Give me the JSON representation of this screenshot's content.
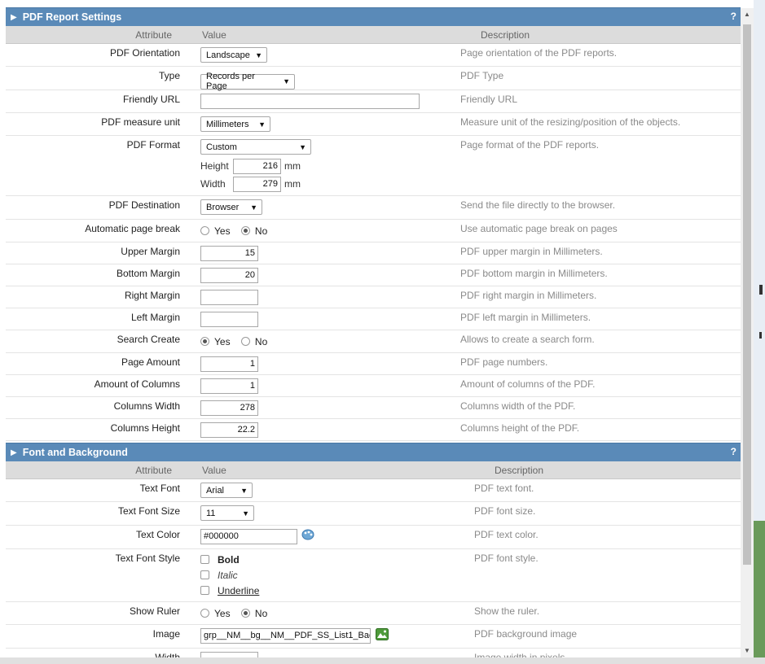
{
  "pdf_section": {
    "title": "PDF Report Settings",
    "help": "?",
    "columns": {
      "attribute": "Attribute",
      "value": "Value",
      "description": "Description"
    },
    "orientation": {
      "label": "PDF Orientation",
      "value": "Landscape",
      "desc": "Page orientation of the PDF reports."
    },
    "type": {
      "label": "Type",
      "value": "Records per Page",
      "desc": "PDF Type"
    },
    "friendly_url": {
      "label": "Friendly URL",
      "value": "",
      "desc": "Friendly URL"
    },
    "measure_unit": {
      "label": "PDF measure unit",
      "value": "Millimeters",
      "desc": "Measure unit of the resizing/position of the objects."
    },
    "format": {
      "label": "PDF Format",
      "value": "Custom",
      "desc": "Page format of the PDF reports.",
      "height_label": "Height",
      "height_value": "216",
      "width_label": "Width",
      "width_value": "279",
      "unit": "mm"
    },
    "destination": {
      "label": "PDF Destination",
      "value": "Browser",
      "desc": "Send the file directly to the browser."
    },
    "auto_page_break": {
      "label": "Automatic page break",
      "yes": "Yes",
      "no": "No",
      "selected": "No",
      "desc": "Use automatic page break on pages"
    },
    "upper_margin": {
      "label": "Upper Margin",
      "value": "15",
      "desc": "PDF upper margin in Millimeters."
    },
    "bottom_margin": {
      "label": "Bottom Margin",
      "value": "20",
      "desc": "PDF bottom margin in Millimeters."
    },
    "right_margin": {
      "label": "Right Margin",
      "value": "",
      "desc": "PDF right margin in Millimeters."
    },
    "left_margin": {
      "label": "Left Margin",
      "value": "",
      "desc": "PDF left margin in Millimeters."
    },
    "search_create": {
      "label": "Search Create",
      "yes": "Yes",
      "no": "No",
      "selected": "Yes",
      "desc": "Allows to create a search form."
    },
    "page_amount": {
      "label": "Page Amount",
      "value": "1",
      "desc": "PDF page numbers."
    },
    "amount_columns": {
      "label": "Amount of Columns",
      "value": "1",
      "desc": "Amount of columns of the PDF."
    },
    "columns_width": {
      "label": "Columns Width",
      "value": "278",
      "desc": "Columns width of the PDF."
    },
    "columns_height": {
      "label": "Columns Height",
      "value": "22.2",
      "desc": "Columns height of the PDF."
    }
  },
  "font_section": {
    "title": "Font and Background",
    "help": "?",
    "columns": {
      "attribute": "Attribute",
      "value": "Value",
      "description": "Description"
    },
    "text_font": {
      "label": "Text Font",
      "value": "Arial",
      "desc": "PDF text font."
    },
    "text_font_size": {
      "label": "Text Font Size",
      "value": "11",
      "desc": "PDF font size."
    },
    "text_color": {
      "label": "Text Color",
      "value": "#000000",
      "desc": "PDF text color."
    },
    "text_font_style": {
      "label": "Text Font Style",
      "bold": "Bold",
      "italic": "Italic",
      "underline": "Underline",
      "desc": "PDF font style."
    },
    "show_ruler": {
      "label": "Show Ruler",
      "yes": "Yes",
      "no": "No",
      "selected": "No",
      "desc": "Show the ruler."
    },
    "image": {
      "label": "Image",
      "value": "grp__NM__bg__NM__PDF_SS_List1_Bac",
      "desc": "PDF background image"
    },
    "width": {
      "label": "Width",
      "value": "",
      "desc": "Image width in pixels"
    }
  },
  "colors": {
    "header_bg": "#5a8ab8",
    "column_header_bg": "#dcdcdc",
    "description_text": "#8a8a8a"
  }
}
